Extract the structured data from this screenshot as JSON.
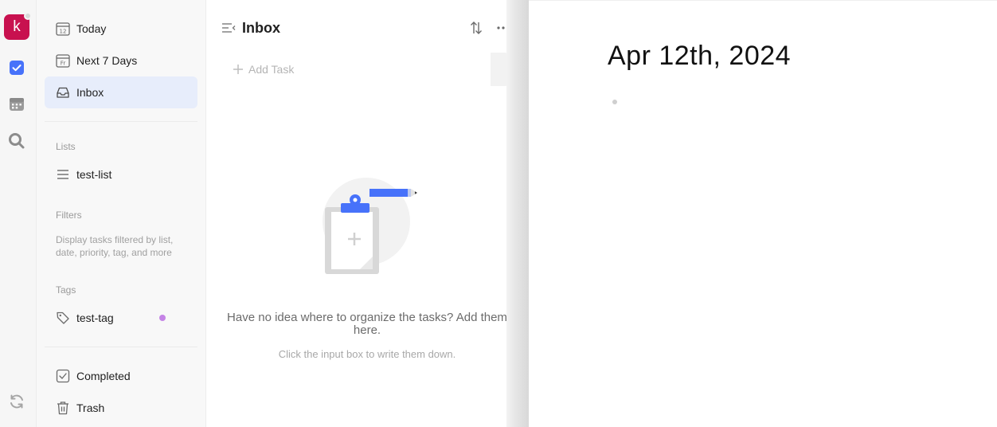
{
  "rail": {
    "avatar_letter": "k",
    "icons": [
      "tasks-icon",
      "calendar-icon",
      "search-icon",
      "sync-icon"
    ],
    "accent_color": "#4772fa",
    "avatar_color": "#c8114f"
  },
  "sidebar": {
    "top_items": [
      {
        "label": "Today",
        "icon": "calendar-day-icon",
        "icon_text": "12"
      },
      {
        "label": "Next 7 Days",
        "icon": "calendar-week-icon",
        "icon_text": "Fr"
      },
      {
        "label": "Inbox",
        "icon": "inbox-icon",
        "active": true
      }
    ],
    "lists_title": "Lists",
    "lists": [
      {
        "label": "test-list",
        "icon": "list-icon"
      }
    ],
    "filters_title": "Filters",
    "filters_desc": "Display tasks filtered by list, date, priority, tag, and more",
    "tags_title": "Tags",
    "tags": [
      {
        "label": "test-tag",
        "icon": "tag-icon",
        "color": "#c584e6"
      }
    ],
    "bottom_items": [
      {
        "label": "Completed",
        "icon": "check-square-icon"
      },
      {
        "label": "Trash",
        "icon": "trash-icon"
      }
    ]
  },
  "tasks": {
    "title": "Inbox",
    "add_placeholder": "Add Task",
    "empty_title": "Have no idea where to organize the tasks? Add them here.",
    "empty_sub": "Click the input box to write them down."
  },
  "detail": {
    "date": "Apr 12th, 2024"
  }
}
